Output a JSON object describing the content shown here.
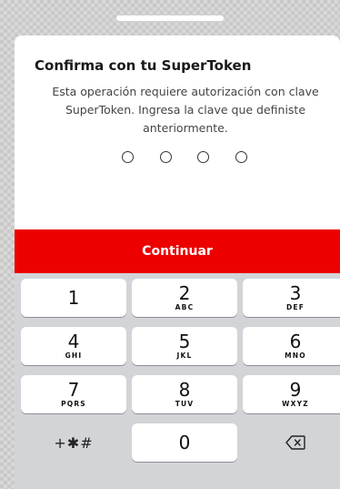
{
  "header": {
    "title": "Confirma con tu SuperToken",
    "description": "Esta operación requiere autorización con clave SuperToken. Ingresa la clave que definiste anteriormente."
  },
  "pin": {
    "length": 4,
    "filled": 0
  },
  "continue_label": "Continuar",
  "keypad": {
    "keys": [
      {
        "digit": "1",
        "letters": ""
      },
      {
        "digit": "2",
        "letters": "ABC"
      },
      {
        "digit": "3",
        "letters": "DEF"
      },
      {
        "digit": "4",
        "letters": "GHI"
      },
      {
        "digit": "5",
        "letters": "JKL"
      },
      {
        "digit": "6",
        "letters": "MNO"
      },
      {
        "digit": "7",
        "letters": "PQRS"
      },
      {
        "digit": "8",
        "letters": "TUV"
      },
      {
        "digit": "9",
        "letters": "WXYZ"
      }
    ],
    "symbols_label": "+✱#",
    "zero": "0",
    "delete_icon": "backspace-icon"
  },
  "colors": {
    "accent": "#ec0000",
    "keypad_bg": "#d2d4d8",
    "key_bg": "#ffffff"
  }
}
